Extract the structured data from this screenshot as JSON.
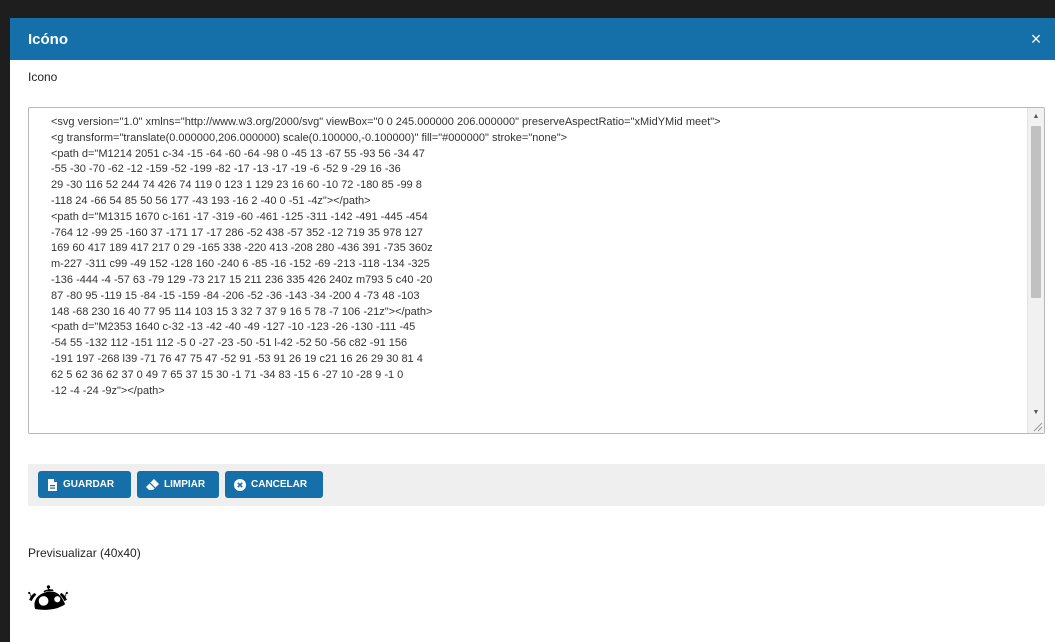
{
  "modal": {
    "title": "Icóno",
    "close_symbol": "×"
  },
  "form": {
    "field_label": "Icono",
    "svg_code": "<svg version=\"1.0\" xmlns=\"http://www.w3.org/2000/svg\" viewBox=\"0 0 245.000000 206.000000\" preserveAspectRatio=\"xMidYMid meet\">\n<g transform=\"translate(0.000000,206.000000) scale(0.100000,-0.100000)\" fill=\"#000000\" stroke=\"none\">\n<path d=\"M1214 2051 c-34 -15 -64 -60 -64 -98 0 -45 13 -67 55 -93 56 -34 47\n-55 -30 -70 -62 -12 -159 -52 -199 -82 -17 -13 -17 -19 -6 -52 9 -29 16 -36\n29 -30 116 52 244 74 426 74 119 0 123 1 129 23 16 60 -10 72 -180 85 -99 8\n-118 24 -66 54 85 50 56 177 -43 193 -16 2 -40 0 -51 -4z\"></path>\n<path d=\"M1315 1670 c-161 -17 -319 -60 -461 -125 -311 -142 -491 -445 -454\n-764 12 -99 25 -160 37 -171 17 -17 286 -52 438 -57 352 -12 719 35 978 127\n169 60 417 189 417 217 0 29 -165 338 -220 413 -208 280 -436 391 -735 360z\nm-227 -311 c99 -49 152 -128 160 -240 6 -85 -16 -152 -69 -213 -118 -134 -325\n-136 -444 -4 -57 63 -79 129 -73 217 15 211 236 335 426 240z m793 5 c40 -20\n87 -80 95 -119 15 -84 -15 -159 -84 -206 -52 -36 -143 -34 -200 4 -73 48 -103\n148 -68 230 16 40 77 95 114 103 15 3 32 7 37 9 16 5 78 -7 106 -21z\"></path>\n<path d=\"M2353 1640 c-32 -13 -42 -40 -49 -127 -10 -123 -26 -130 -111 -45\n-54 55 -132 112 -151 112 -5 0 -27 -23 -50 -51 l-42 -52 50 -56 c82 -91 156\n-191 197 -268 l39 -71 76 47 75 47 -52 91 -53 91 26 19 c21 16 26 29 30 81 4\n62 5 62 36 62 37 0 49 7 65 37 15 30 -1 71 -34 83 -15 6 -27 10 -28 9 -1 0\n-12 -4 -24 -9z\"></path>"
  },
  "actions": {
    "save_label": "GUARDAR",
    "clear_label": "LIMPIAR",
    "cancel_label": "CANCELAR"
  },
  "preview": {
    "label": "Previsualizar (40x40)"
  },
  "icons": {
    "close": "close-icon",
    "save": "file-save-icon",
    "clear": "eraser-icon",
    "cancel": "x-circle-icon",
    "preview": "robot-icon"
  },
  "colors": {
    "header": "#156fa8",
    "button": "#156fa8",
    "button_bar": "#efefef"
  }
}
